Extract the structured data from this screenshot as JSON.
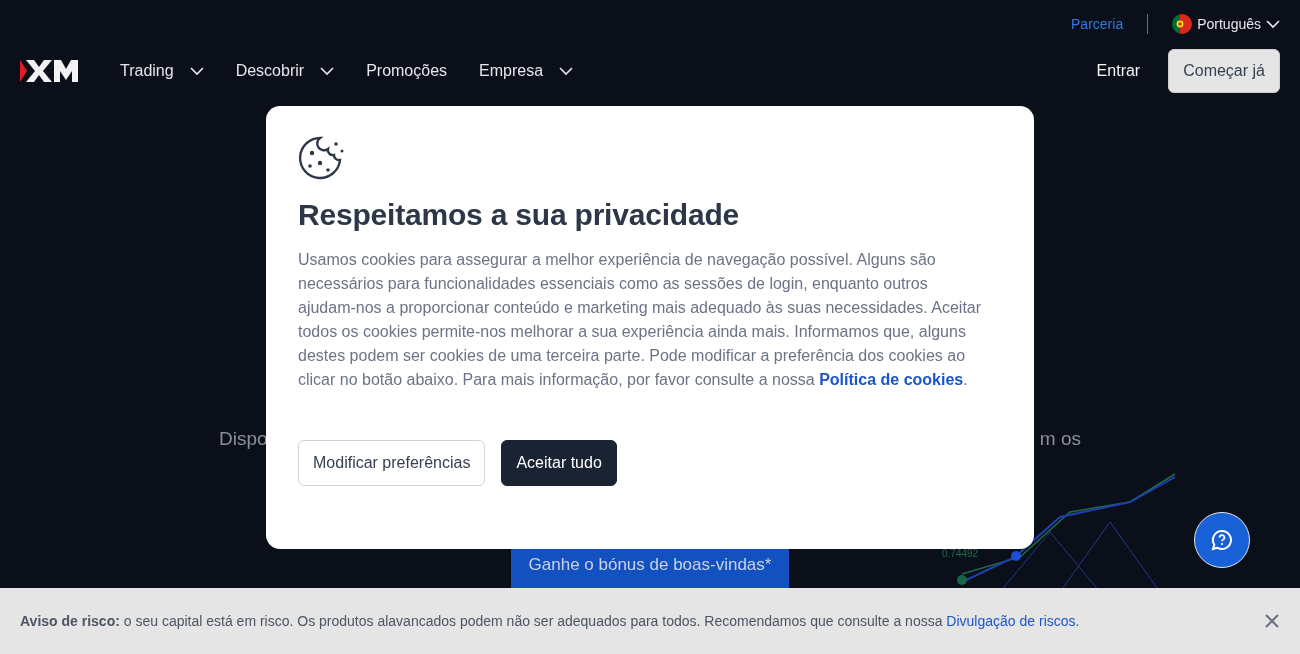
{
  "top_bar": {
    "partner_link": "Parceria",
    "language": "Português"
  },
  "nav": {
    "items": [
      {
        "label": "Trading",
        "has_dropdown": true
      },
      {
        "label": "Descobrir",
        "has_dropdown": true
      },
      {
        "label": "Promoções",
        "has_dropdown": false
      },
      {
        "label": "Empresa",
        "has_dropdown": true
      }
    ],
    "login": "Entrar",
    "start_button": "Começar já"
  },
  "hero": {
    "left_fragment": "Dispo",
    "right_fragment": "m os",
    "bonus_button": "Ganhe o bónus de boas-vindas*",
    "chart_label": "0.74492"
  },
  "cookie_dialog": {
    "title": "Respeitamos a sua privacidade",
    "text": "Usamos cookies para assegurar a melhor experiência de navegação possível. Alguns são necessários para funcionalidades essenciais como as sessões de login, enquanto outros ajudam-nos a proporcionar conteúdo e marketing mais adequado às suas necessidades. Aceitar todos os cookies permite-nos melhorar a sua experiência ainda mais. Informamos que, alguns destes podem ser cookies de uma terceira parte. Pode modificar a preferência dos cookies ao clicar no botão abaixo. Para mais informação, por favor consulte a nossa",
    "link": "Política de cookies",
    "text_after": ".",
    "buttons": [
      {
        "label": "Modificar preferências",
        "kind": "secondary"
      },
      {
        "label": "Aceitar tudo",
        "kind": "primary"
      }
    ]
  },
  "risk_notice": {
    "text": "**Aviso de risco:** o seu capital está em risco. Os produtos alavancados podem não ser adequados para todos. Recomendamos que consulte a nossa",
    "link": "Divulgação de riscos",
    "text_after": "."
  }
}
